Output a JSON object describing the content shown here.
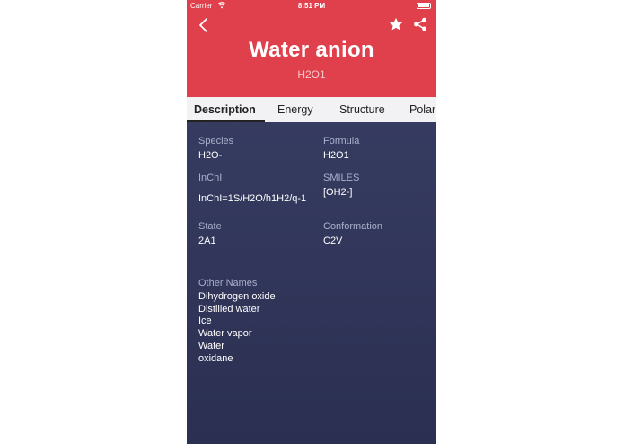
{
  "status_bar": {
    "carrier": "Carrier",
    "time": "8:51 PM"
  },
  "header": {
    "title": "Water anion",
    "subtitle": "H2O1",
    "background": "#e0404c",
    "icons": [
      "back-icon",
      "star-icon",
      "share-icon"
    ]
  },
  "tabs": [
    {
      "label": "Description",
      "active": true
    },
    {
      "label": "Energy",
      "active": false
    },
    {
      "label": "Structure",
      "active": false
    },
    {
      "label": "Polar",
      "active": false
    }
  ],
  "details": {
    "species": {
      "label": "Species",
      "value": "H2O-"
    },
    "formula": {
      "label": "Formula",
      "value": "H2O1"
    },
    "inchi": {
      "label": "InChI",
      "value": "InChI=1S/H2O/h1H2/q-1"
    },
    "smiles": {
      "label": "SMILES",
      "value": "[OH2-]"
    },
    "state": {
      "label": "State",
      "value": "2A1"
    },
    "conformation": {
      "label": "Conformation",
      "value": "C2V"
    }
  },
  "other_names": {
    "label": "Other Names",
    "items": [
      "Dihydrogen oxide",
      "Distilled water",
      "Ice",
      "Water vapor",
      "Water",
      "oxidane"
    ]
  }
}
